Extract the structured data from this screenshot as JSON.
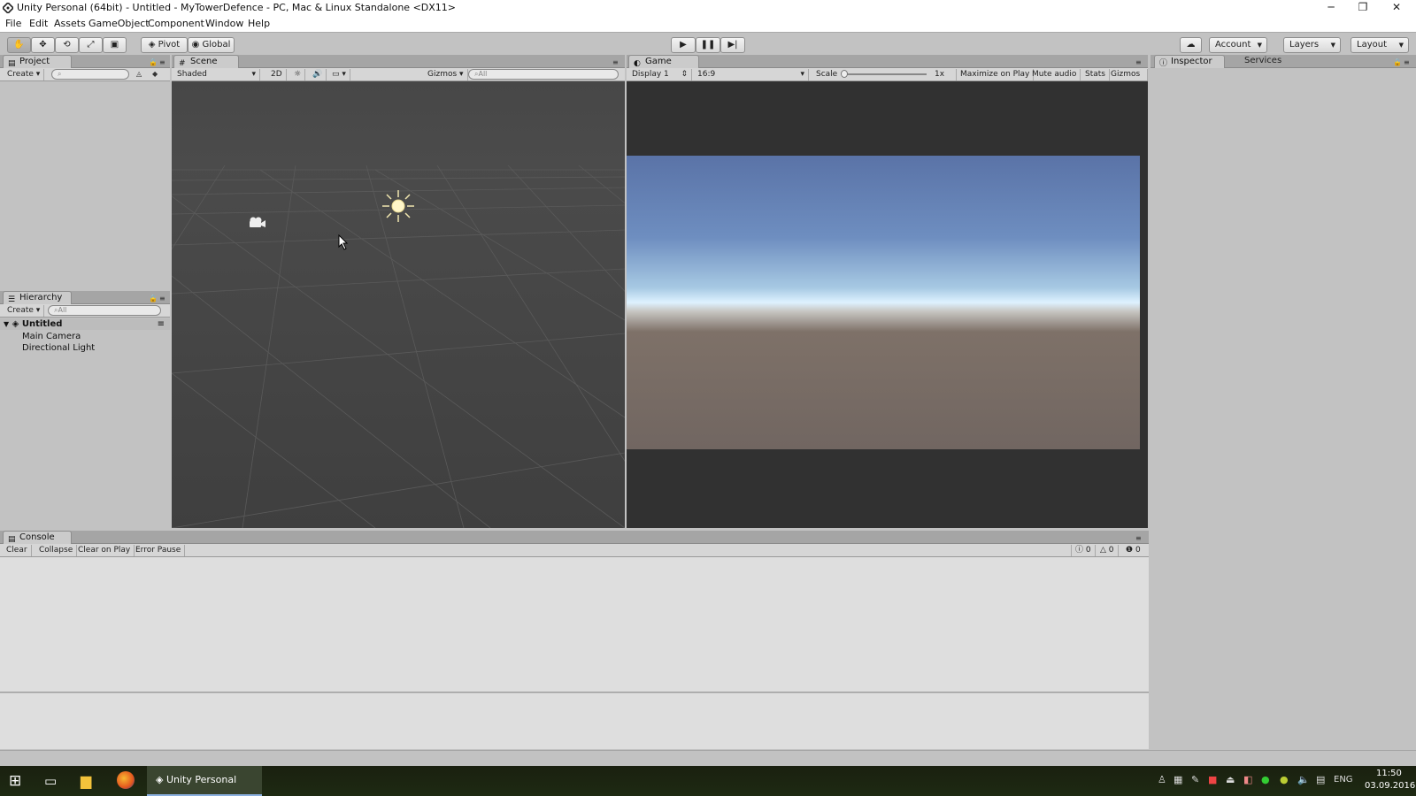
{
  "window": {
    "title": "Unity Personal (64bit) - Untitled - MyTowerDefence - PC, Mac & Linux Standalone <DX11>",
    "minimize": "─",
    "restore": "❐",
    "close": "✕"
  },
  "menu": [
    "File",
    "Edit",
    "Assets",
    "GameObject",
    "Component",
    "Window",
    "Help"
  ],
  "toolbar": {
    "pivot": "Pivot",
    "global": "Global",
    "account": "Account",
    "layers": "Layers",
    "layout": "Layout"
  },
  "project": {
    "tab": "Project",
    "create": "Create"
  },
  "hierarchy": {
    "tab": "Hierarchy",
    "create": "Create",
    "search_placeholder": "All",
    "scene_name": "Untitled",
    "items": [
      "Main Camera",
      "Directional Light"
    ]
  },
  "scene": {
    "tab": "Scene",
    "shading": "Shaded",
    "mode2d": "2D",
    "gizmos": "Gizmos",
    "search_placeholder": "All"
  },
  "game": {
    "tab": "Game",
    "display": "Display 1",
    "aspect": "16:9",
    "scale_label": "Scale",
    "scale_value": "1x",
    "maximize": "Maximize on Play",
    "mute": "Mute audio",
    "stats": "Stats",
    "gizmos": "Gizmos"
  },
  "inspector": {
    "tab": "Inspector",
    "services_tab": "Services"
  },
  "console": {
    "tab": "Console",
    "clear": "Clear",
    "collapse": "Collapse",
    "clear_on_play": "Clear on Play",
    "error_pause": "Error Pause",
    "info_count": "0",
    "warn_count": "0",
    "error_count": "0"
  },
  "taskbar": {
    "active_app": "Unity Personal (64b...",
    "language": "ENG",
    "time": "11:50",
    "date": "03.09.2016"
  }
}
